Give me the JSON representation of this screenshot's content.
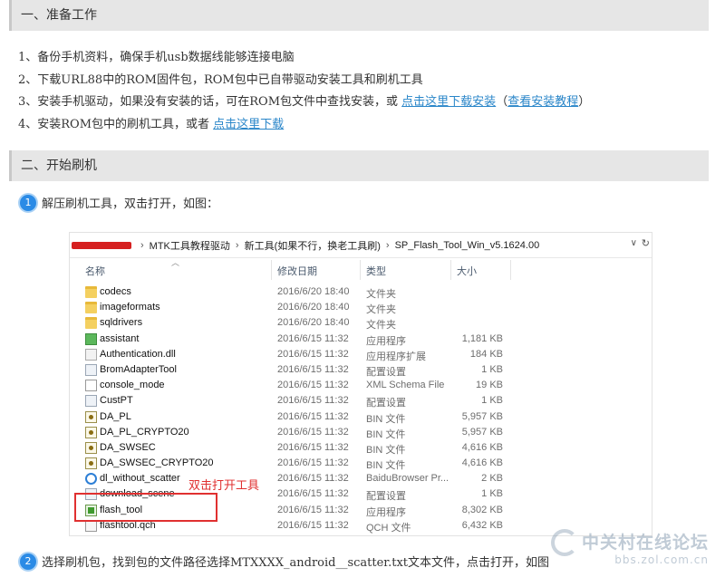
{
  "sections": {
    "prep_title": "一、准备工作",
    "flash_title": "二、开始刷机"
  },
  "prep_steps": [
    {
      "text": "1、备份手机资料，确保手机usb数据线能够连接电脑"
    },
    {
      "text": "2、下载URL88中的ROM固件包，ROM包中已自带驱动安装工具和刷机工具"
    },
    {
      "text": "3、安装手机驱动，如果没有安装的话，可在ROM包文件中查找安装，或 ",
      "link1": "点击这里下载安装",
      "mid": "（",
      "link2": "查看安装教程",
      "end": "）"
    },
    {
      "text": "4、安装ROM包中的刷机工具，或者 ",
      "link1": "点击这里下载"
    }
  ],
  "bullets": [
    {
      "num": "1",
      "text": "解压刷机工具，双击打开，如图："
    },
    {
      "num": "2",
      "text": "选择刷机包，找到包的文件路径选择MTXXXX_android__scatter.txt文本文件，点击打开，如图"
    }
  ],
  "explorer": {
    "breadcrumb": [
      "MTK工具教程驱动",
      "新工具(如果不行，换老工具刷)",
      "SP_Flash_Tool_Win_v5.1624.00"
    ],
    "columns": {
      "name": "名称",
      "date": "修改日期",
      "type": "类型",
      "size": "大小"
    },
    "files": [
      {
        "icon": "folder-icon",
        "cls": "folder",
        "name": "codecs",
        "date": "2016/6/20 18:40",
        "type": "文件夹",
        "size": ""
      },
      {
        "icon": "folder-icon",
        "cls": "folder",
        "name": "imageformats",
        "date": "2016/6/20 18:40",
        "type": "文件夹",
        "size": ""
      },
      {
        "icon": "folder-icon",
        "cls": "folder",
        "name": "sqldrivers",
        "date": "2016/6/20 18:40",
        "type": "文件夹",
        "size": ""
      },
      {
        "icon": "qt-app-icon",
        "cls": "exe-teal",
        "name": "assistant",
        "date": "2016/6/15 11:32",
        "type": "应用程序",
        "size": "1,181 KB"
      },
      {
        "icon": "dll-icon",
        "cls": "dll",
        "name": "Authentication.dll",
        "date": "2016/6/15 11:32",
        "type": "应用程序扩展",
        "size": "184 KB"
      },
      {
        "icon": "config-icon",
        "cls": "cfg",
        "name": "BromAdapterTool",
        "date": "2016/6/15 11:32",
        "type": "配置设置",
        "size": "1 KB"
      },
      {
        "icon": "xml-icon",
        "cls": "xml",
        "name": "console_mode",
        "date": "2016/6/15 11:32",
        "type": "XML Schema File",
        "size": "19 KB"
      },
      {
        "icon": "config-icon",
        "cls": "cfg",
        "name": "CustPT",
        "date": "2016/6/15 11:32",
        "type": "配置设置",
        "size": "1 KB"
      },
      {
        "icon": "bin-icon",
        "cls": "bin",
        "name": "DA_PL",
        "date": "2016/6/15 11:32",
        "type": "BIN 文件",
        "size": "5,957 KB"
      },
      {
        "icon": "bin-icon",
        "cls": "bin",
        "name": "DA_PL_CRYPTO20",
        "date": "2016/6/15 11:32",
        "type": "BIN 文件",
        "size": "5,957 KB"
      },
      {
        "icon": "bin-icon",
        "cls": "bin",
        "name": "DA_SWSEC",
        "date": "2016/6/15 11:32",
        "type": "BIN 文件",
        "size": "4,616 KB"
      },
      {
        "icon": "bin-icon",
        "cls": "bin",
        "name": "DA_SWSEC_CRYPTO20",
        "date": "2016/6/15 11:32",
        "type": "BIN 文件",
        "size": "4,616 KB"
      },
      {
        "icon": "browser-icon",
        "cls": "baidu",
        "name": "dl_without_scatter",
        "date": "2016/6/15 11:32",
        "type": "BaiduBrowser Pr...",
        "size": "2 KB"
      },
      {
        "icon": "config-icon",
        "cls": "cfg",
        "name": "download_scene",
        "date": "2016/6/15 11:32",
        "type": "配置设置",
        "size": "1 KB"
      },
      {
        "icon": "flash-tool-icon",
        "cls": "flash",
        "name": "flash_tool",
        "date": "2016/6/15 11:32",
        "type": "应用程序",
        "size": "8,302 KB"
      },
      {
        "icon": "qch-icon",
        "cls": "qch",
        "name": "flashtool.qch",
        "date": "2016/6/15 11:32",
        "type": "QCH 文件",
        "size": "6,432 KB"
      }
    ]
  },
  "annotation": "双击打开工具",
  "watermark": {
    "line1": "中关村在线论坛",
    "line2": "bbs.zol.com.cn"
  },
  "colors": {
    "link": "#2a86c9",
    "annotation": "#e03030",
    "bullet": "#2b8be6"
  }
}
